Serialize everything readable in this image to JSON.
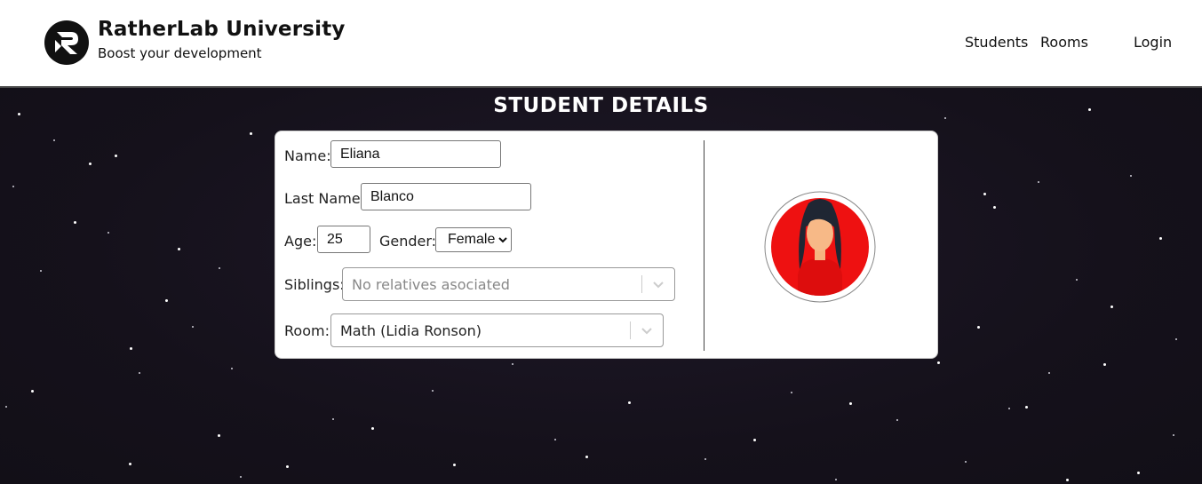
{
  "header": {
    "brand_title": "RatherLab University",
    "brand_subtitle": "Boost your development",
    "nav": {
      "students": "Students",
      "rooms": "Rooms",
      "login": "Login"
    }
  },
  "page": {
    "title": "STUDENT DETAILS"
  },
  "form": {
    "name_label": "Name:",
    "name_value": "Eliana",
    "last_name_label": "Last Name:",
    "last_name_value": "Blanco",
    "age_label": "Age:",
    "age_value": "25",
    "gender_label": "Gender:",
    "gender_value": "Female",
    "siblings_label": "Siblings:",
    "siblings_placeholder": "No relatives asociated",
    "room_label": "Room:",
    "room_value": "Math (Lidia Ronson)"
  },
  "icons": {
    "logo": "ratherlab-r-logo",
    "avatar": "female-avatar",
    "dropdown": "chevron-down-icon"
  },
  "colors": {
    "header_bg": "#ffffff",
    "background": "#16121c",
    "avatar_bg": "#ee1111",
    "card_bg": "#ffffff"
  }
}
